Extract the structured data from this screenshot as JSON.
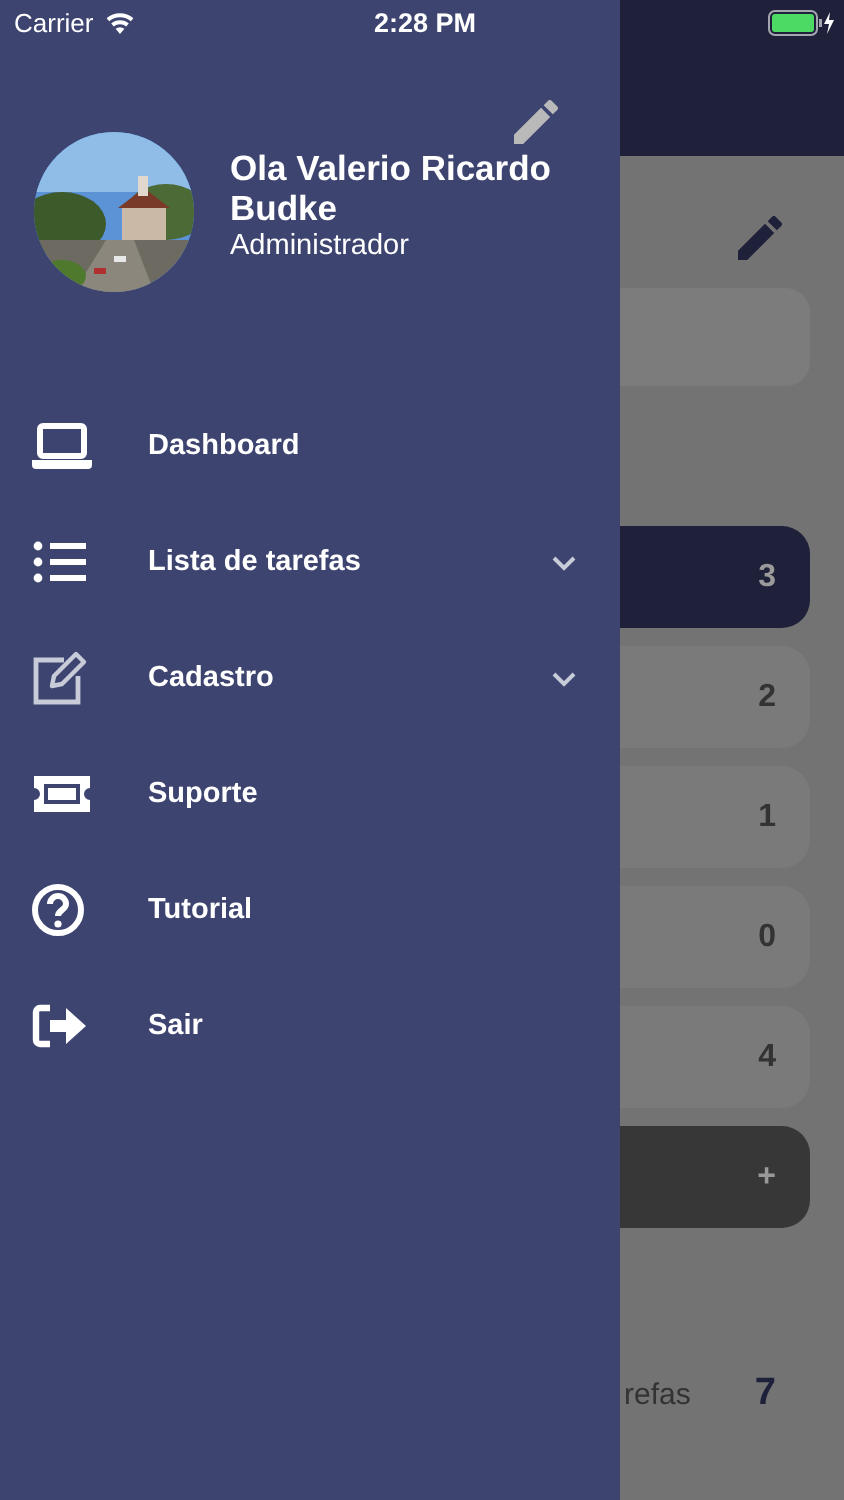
{
  "status_bar": {
    "carrier": "Carrier",
    "time": "2:28 PM"
  },
  "drawer": {
    "user_name": "Ola Valerio Ricardo Budke",
    "user_role": "Administrador",
    "items": [
      {
        "label": "Dashboard",
        "kind": "link"
      },
      {
        "label": "Lista de tarefas",
        "kind": "group",
        "expanded": false
      },
      {
        "label": "Cadastro",
        "kind": "group",
        "expanded": false
      },
      {
        "label": "Suporte",
        "kind": "link"
      },
      {
        "label": "Tutorial",
        "kind": "link"
      },
      {
        "label": "Sair",
        "kind": "link"
      }
    ]
  },
  "background": {
    "cards": [
      {
        "count": "3",
        "kind": "count",
        "selected": true
      },
      {
        "count": "2",
        "kind": "count",
        "selected": false
      },
      {
        "count": "1",
        "kind": "count",
        "selected": false
      },
      {
        "count": "0",
        "kind": "count",
        "selected": false
      },
      {
        "count": "4",
        "kind": "count",
        "selected": false
      },
      {
        "count": "+",
        "kind": "add"
      }
    ],
    "summary_label": "refas",
    "summary_value": "7"
  }
}
